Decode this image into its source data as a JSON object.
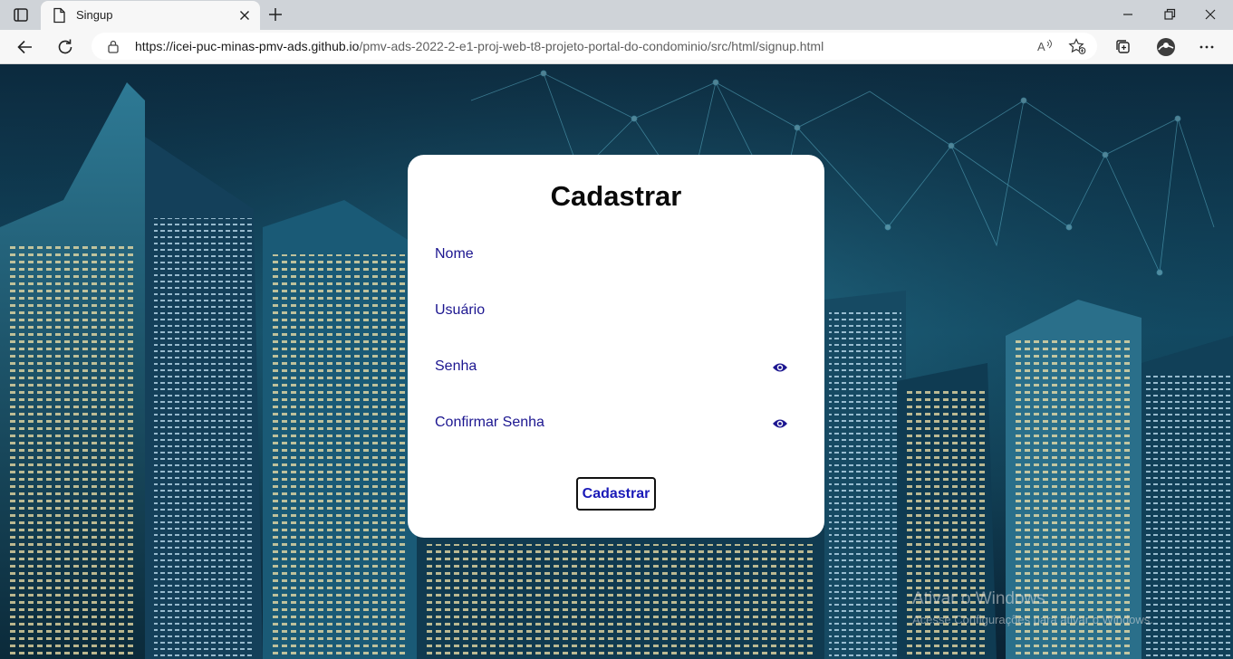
{
  "browser": {
    "tab_title": "Singup",
    "url_host": "https://icei-puc-minas-pmv-ads.github.io",
    "url_path": "/pmv-ads-2022-2-e1-proj-web-t8-projeto-portal-do-condominio/src/html/signup.html"
  },
  "form": {
    "title": "Cadastrar",
    "fields": [
      {
        "label": "Nome"
      },
      {
        "label": "Usuário"
      },
      {
        "label": "Senha"
      },
      {
        "label": "Confirmar Senha"
      }
    ],
    "submit_label": "Cadastrar"
  },
  "watermark": {
    "title": "Ativar o Windows",
    "subtitle": "Acesse Configurações para ativar o Windows."
  },
  "colors": {
    "label": "#1c1690",
    "button_text": "#1a1ab8",
    "background": "#124a63"
  },
  "icons": {
    "password_toggle": "eye-icon"
  }
}
